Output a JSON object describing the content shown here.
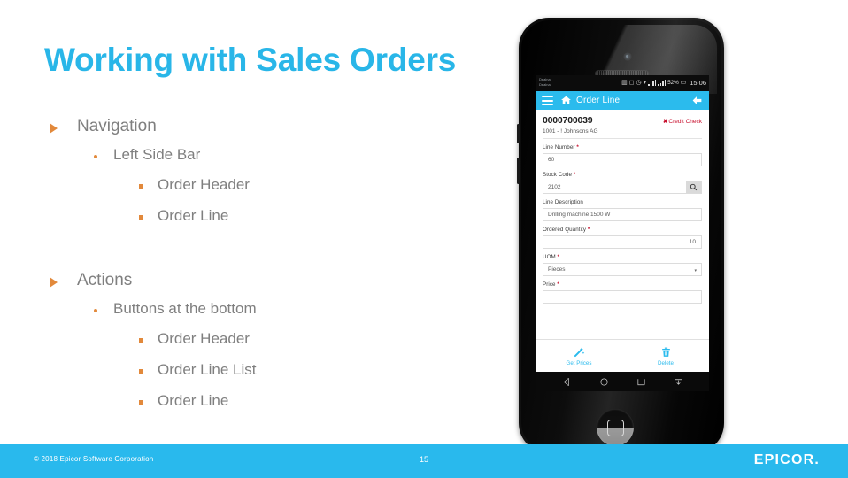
{
  "slide": {
    "title": "Working with Sales Orders",
    "accent_color": "#29b6e8",
    "bullet_color": "#e2893b",
    "text_color": "#7f7f7f"
  },
  "bullets": [
    {
      "level": 1,
      "text": "Navigation"
    },
    {
      "level": 2,
      "text": "Left Side Bar"
    },
    {
      "level": 3,
      "text": "Order Header"
    },
    {
      "level": 3,
      "text": "Order Line"
    },
    {
      "level": 1,
      "text": "Actions"
    },
    {
      "level": 2,
      "text": "Buttons at the bottom"
    },
    {
      "level": 3,
      "text": "Order Header"
    },
    {
      "level": 3,
      "text": "Order Line List"
    },
    {
      "level": 3,
      "text": "Order Line"
    }
  ],
  "footer": {
    "copyright": "© 2018 Epicor Software Corporation",
    "page_number": "15",
    "logo": "EPICOR.",
    "background_color": "#29b9ed"
  },
  "phone": {
    "statusbar": {
      "left_text_line1": "Dealna",
      "left_text_line2": "Dealna",
      "battery": "52%",
      "time": "15:06"
    },
    "appbar": {
      "title": "Order Line",
      "background_color": "#2bbbed",
      "menu_icon": "hamburger-icon",
      "home_icon": "home-icon",
      "back_icon": "back-arrow-icon"
    },
    "form": {
      "order_number": "0000700039",
      "credit_check": "Credit Check",
      "credit_check_color": "#c8102e",
      "customer": "1001 - ! Johnsons AG",
      "fields": [
        {
          "label": "Line Number",
          "required": true,
          "value": "60",
          "type": "text"
        },
        {
          "label": "Stock Code",
          "required": true,
          "value": "2102",
          "type": "search"
        },
        {
          "label": "Line Description",
          "required": false,
          "value": "Drilling machine 1500 W",
          "type": "text"
        },
        {
          "label": "Ordered Quantity",
          "required": true,
          "value": "10",
          "type": "number"
        },
        {
          "label": "UOM",
          "required": true,
          "value": "Pieces",
          "type": "select"
        },
        {
          "label": "Price",
          "required": true,
          "value": "",
          "type": "text"
        }
      ]
    },
    "actions": [
      {
        "label": "Get Prices",
        "icon": "magic-wand-icon",
        "color": "#2bbbed"
      },
      {
        "label": "Delete",
        "icon": "trash-icon",
        "color": "#2bbbed"
      }
    ],
    "navbar": [
      {
        "icon": "nav-back-icon"
      },
      {
        "icon": "nav-home-icon"
      },
      {
        "icon": "nav-recents-icon"
      },
      {
        "icon": "nav-keyboard-icon"
      }
    ]
  }
}
